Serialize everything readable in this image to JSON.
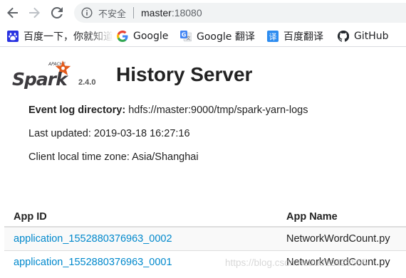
{
  "browser": {
    "security_label": "不安全",
    "url_host": "master",
    "url_port": ":18080"
  },
  "bookmarks": [
    {
      "label": "百度一下，你就知道",
      "icon": "baidu-paw-icon"
    },
    {
      "label": "Google",
      "icon": "google-g-icon"
    },
    {
      "label": "Google 翻译",
      "icon": "google-translate-icon"
    },
    {
      "label": "百度翻译",
      "icon": "baidu-translate-icon"
    },
    {
      "label": "GitHub",
      "icon": "github-icon"
    }
  ],
  "header": {
    "logo_text": "Spark",
    "logo_small_text": "APACHE",
    "version": "2.4.0",
    "title": "History Server"
  },
  "info": {
    "event_log_label": "Event log directory:",
    "event_log_value": "hdfs://master:9000/tmp/spark-yarn-logs",
    "last_updated": "Last updated: 2019-03-18 16:27:16",
    "timezone": "Client local time zone: Asia/Shanghai"
  },
  "table": {
    "columns": [
      "App ID",
      "App Name"
    ],
    "rows": [
      {
        "app_id": "application_1552880376963_0002",
        "app_name": "NetworkWordCount.py"
      },
      {
        "app_id": "application_1552880376963_0001",
        "app_name": "NetworkWordCount.py"
      }
    ]
  },
  "watermark": "https://blog.csdn.net/u012429555",
  "colors": {
    "link": "#0088cc",
    "spark_orange": "#e25a1c",
    "spark_gray": "#3c3a3e"
  }
}
